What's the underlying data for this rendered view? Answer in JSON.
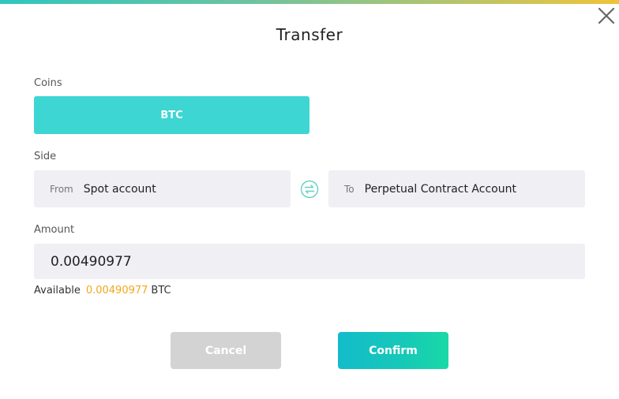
{
  "dialog": {
    "title": "Transfer",
    "close_icon": "close-icon"
  },
  "coins": {
    "label": "Coins",
    "selected": "BTC"
  },
  "side": {
    "label": "Side",
    "from_tag": "From",
    "from_value": "Spot account",
    "to_tag": "To",
    "to_value": "Perpetual Contract Account",
    "swap_icon": "swap-arrows-icon"
  },
  "amount": {
    "label": "Amount",
    "value": "0.00490977",
    "available_label": "Available",
    "available_value": "0.00490977",
    "available_unit": "BTC"
  },
  "buttons": {
    "cancel": "Cancel",
    "confirm": "Confirm"
  },
  "colors": {
    "accent": "#3dd6d3",
    "available_highlight": "#f0a81c",
    "cancel_bg": "#d3d3d3"
  }
}
